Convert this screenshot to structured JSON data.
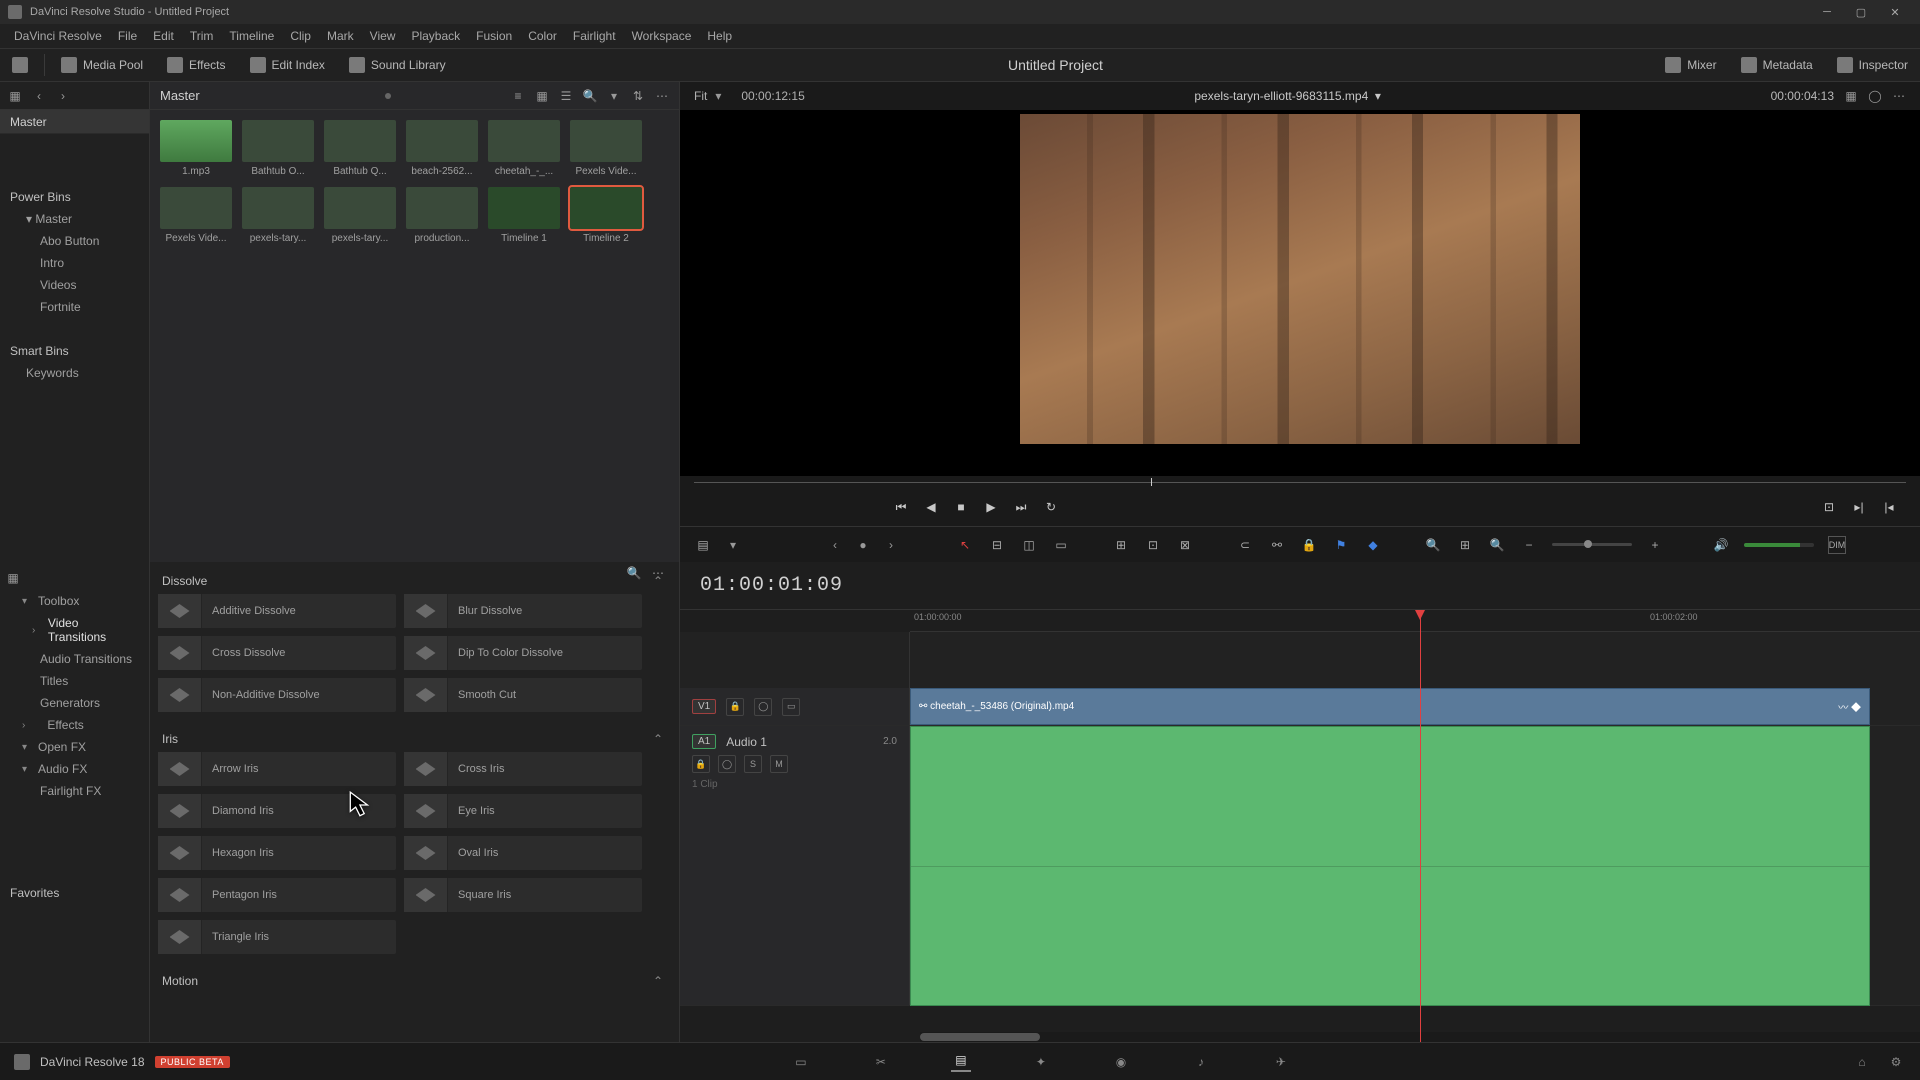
{
  "window": {
    "title": "DaVinci Resolve Studio - Untitled Project"
  },
  "menu": [
    "DaVinci Resolve",
    "File",
    "Edit",
    "Trim",
    "Timeline",
    "Clip",
    "Mark",
    "View",
    "Playback",
    "Fusion",
    "Color",
    "Fairlight",
    "Workspace",
    "Help"
  ],
  "toolbar": {
    "media_pool": "Media Pool",
    "effects": "Effects",
    "edit_index": "Edit Index",
    "sound_library": "Sound Library",
    "mixer": "Mixer",
    "metadata": "Metadata",
    "inspector": "Inspector",
    "project": "Untitled Project"
  },
  "bins": {
    "master": "Master",
    "power_bins_header": "Power Bins",
    "power_bins": [
      "Master",
      "Abo Button",
      "Intro",
      "Videos",
      "Fortnite"
    ],
    "smart_bins_header": "Smart Bins",
    "smart_bins": [
      "Keywords"
    ]
  },
  "media_head": {
    "crumb": "Master"
  },
  "thumbs": [
    {
      "label": "1.mp3",
      "kind": "audio"
    },
    {
      "label": "Bathtub O...",
      "kind": "vid"
    },
    {
      "label": "Bathtub Q...",
      "kind": "vid"
    },
    {
      "label": "beach-2562...",
      "kind": "vid"
    },
    {
      "label": "cheetah_-_...",
      "kind": "vid"
    },
    {
      "label": "Pexels Vide...",
      "kind": "vid"
    },
    {
      "label": "Pexels Vide...",
      "kind": "vid"
    },
    {
      "label": "pexels-tary...",
      "kind": "vid"
    },
    {
      "label": "pexels-tary...",
      "kind": "vid"
    },
    {
      "label": "production...",
      "kind": "vid"
    },
    {
      "label": "Timeline 1",
      "kind": "tl"
    },
    {
      "label": "Timeline 2",
      "kind": "tl",
      "selected": true
    }
  ],
  "viewer": {
    "fit": "Fit",
    "src_tc": "00:00:12:15",
    "clip": "pexels-taryn-elliott-9683115.mp4",
    "rec_tc": "00:00:04:13"
  },
  "tl_tc": "01:00:01:09",
  "ruler": [
    "01:00:00:00",
    "01:00:02:00"
  ],
  "vtrack": {
    "badge": "V1",
    "clipname": "cheetah_-_53486 (Original).mp4"
  },
  "atrack": {
    "badge": "A1",
    "name": "Audio 1",
    "db": "2.0",
    "sub": "1 Clip",
    "s": "S",
    "m": "M"
  },
  "eff_side": {
    "toolbox": "Toolbox",
    "video_trans": "Video Transitions",
    "audio_trans": "Audio Transitions",
    "titles": "Titles",
    "generators": "Generators",
    "effects": "Effects",
    "openfx": "Open FX",
    "audiofx": "Audio FX",
    "fairlightfx": "Fairlight FX",
    "favorites": "Favorites"
  },
  "eff_groups": {
    "dissolve": {
      "title": "Dissolve",
      "items": [
        "Additive Dissolve",
        "Blur Dissolve",
        "Cross Dissolve",
        "Dip To Color Dissolve",
        "Non-Additive Dissolve",
        "Smooth Cut"
      ]
    },
    "iris": {
      "title": "Iris",
      "items": [
        "Arrow Iris",
        "Cross Iris",
        "Diamond Iris",
        "Eye Iris",
        "Hexagon Iris",
        "Oval Iris",
        "Pentagon Iris",
        "Square Iris",
        "Triangle Iris"
      ]
    },
    "motion": {
      "title": "Motion"
    }
  },
  "footer": {
    "app": "DaVinci Resolve 18",
    "beta": "PUBLIC BETA"
  }
}
